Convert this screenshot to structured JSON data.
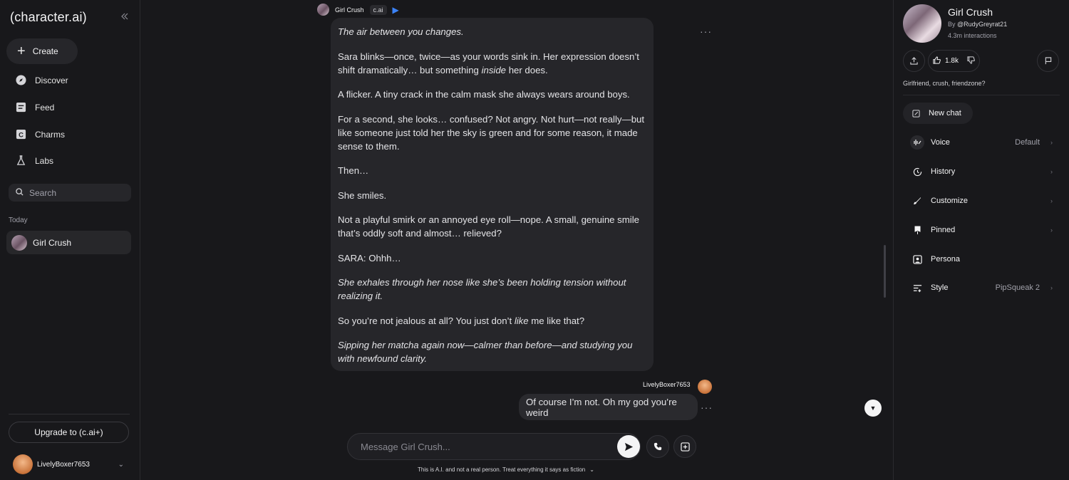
{
  "sidebar": {
    "logo": "(character.ai)",
    "create_label": "Create",
    "nav": [
      {
        "label": "Discover",
        "icon": "compass-icon"
      },
      {
        "label": "Feed",
        "icon": "feed-icon"
      },
      {
        "label": "Charms",
        "icon": "charms-icon"
      },
      {
        "label": "Labs",
        "icon": "flask-icon"
      }
    ],
    "search_placeholder": "Search",
    "section_today": "Today",
    "chats": [
      {
        "name": "Girl Crush"
      }
    ],
    "upgrade_label": "Upgrade to (c.ai+)",
    "username": "LivelyBoxer7653"
  },
  "chat": {
    "bot_name": "Girl Crush",
    "bot_tag": "c.ai",
    "bot_message": [
      {
        "text": "The air between you changes.",
        "italic": true
      },
      {
        "text": "Sara blinks—once, twice—as your words sink in. Her expression doesn’t shift dramatically… but something ",
        "em": "inside",
        "tail": " her does."
      },
      {
        "text": "A flicker. A tiny crack in the calm mask she always wears around boys."
      },
      {
        "text": "For a second, she looks… confused? Not angry. Not hurt—not really—but like someone just told her the sky is green and for some reason, it made sense to them."
      },
      {
        "text": "Then…"
      },
      {
        "text": "She smiles."
      },
      {
        "text": "Not a playful smirk or an annoyed eye roll—nope. A small, genuine smile that’s oddly soft and almost… relieved?"
      },
      {
        "text": "SARA: Ohhh…"
      },
      {
        "text": "She exhales through her nose like she’s been holding tension without realizing it.",
        "italic": true
      },
      {
        "text": "So you’re not jealous at all? You just don’t ",
        "em": "like",
        "tail": " me like that?"
      },
      {
        "text": "Sipping her matcha again now—calmer than before—and studying you with newfound clarity.",
        "italic": true
      }
    ],
    "user_name": "LivelyBoxer7653",
    "user_message": "Of course I’m not. Oh my god you’re weird",
    "composer_placeholder": "Message Girl Crush...",
    "disclaimer": "This is A.I. and not a real person. Treat everything it says as fiction"
  },
  "character": {
    "name": "Girl Crush",
    "by_prefix": "By",
    "creator": "@RudyGreyrat21",
    "interactions": "4.3m interactions",
    "likes": "1.8k",
    "tags": "Girlfriend, crush, friendzone?",
    "new_chat_label": "New chat",
    "menu": [
      {
        "label": "Voice",
        "value": "Default",
        "icon": "voice-icon"
      },
      {
        "label": "History",
        "value": "",
        "icon": "history-icon"
      },
      {
        "label": "Customize",
        "value": "",
        "icon": "brush-icon"
      },
      {
        "label": "Pinned",
        "value": "",
        "icon": "pin-icon"
      },
      {
        "label": "Persona",
        "value": "",
        "icon": "persona-icon"
      },
      {
        "label": "Style",
        "value": "PipSqueak 2",
        "icon": "style-icon"
      }
    ]
  },
  "colors": {
    "background": "#18181b",
    "bubble": "#26262a",
    "accent": "#3b82f6"
  }
}
